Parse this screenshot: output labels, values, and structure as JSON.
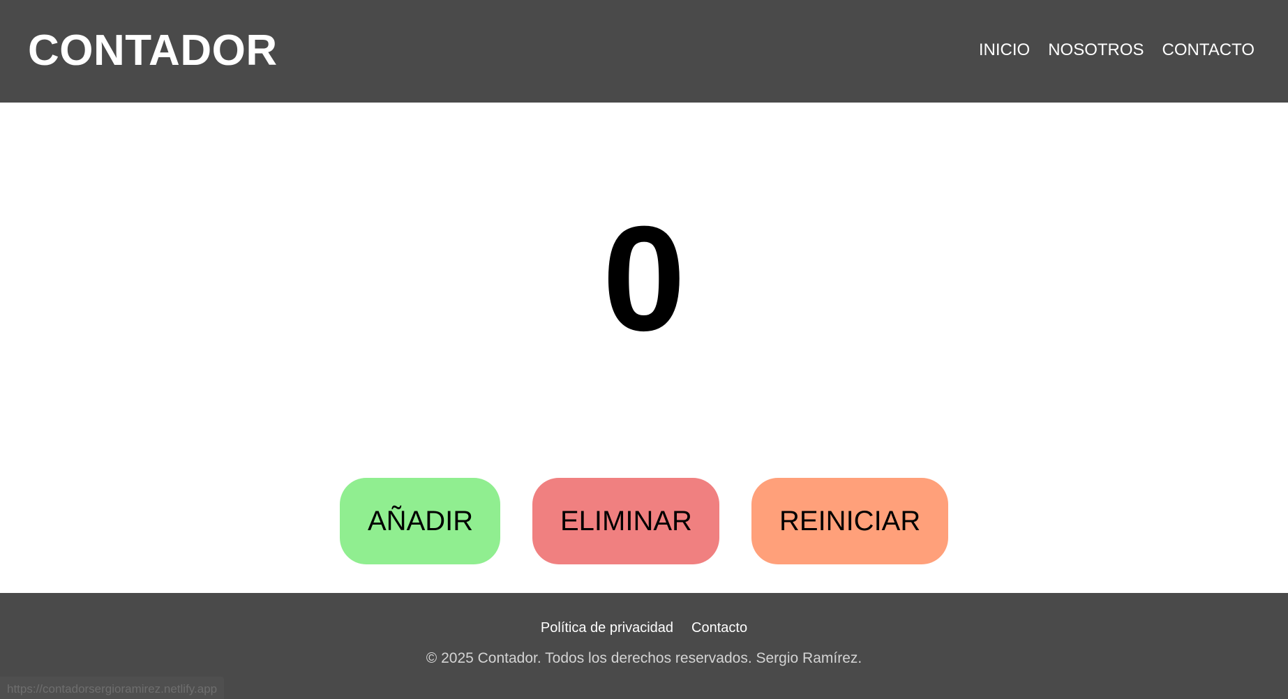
{
  "header": {
    "brand": "CONTADOR",
    "nav": [
      "INICIO",
      "NOSOTROS",
      "CONTACTO"
    ]
  },
  "counter": {
    "value": "0"
  },
  "buttons": {
    "add_label": "AÑADIR",
    "remove_label": "ELIMINAR",
    "reset_label": "REINICIAR"
  },
  "footer": {
    "links": [
      "Política de privacidad",
      "Contacto"
    ],
    "copyright": "© 2025 Contador. Todos los derechos reservados. Sergio Ramírez."
  },
  "status_bar": {
    "url": "https://contadorsergioramirez.netlify.app"
  },
  "colors": {
    "header_bg": "#4a4a4a",
    "add_button": "#90ee90",
    "remove_button": "#f08080",
    "reset_button": "#ffa07a"
  }
}
